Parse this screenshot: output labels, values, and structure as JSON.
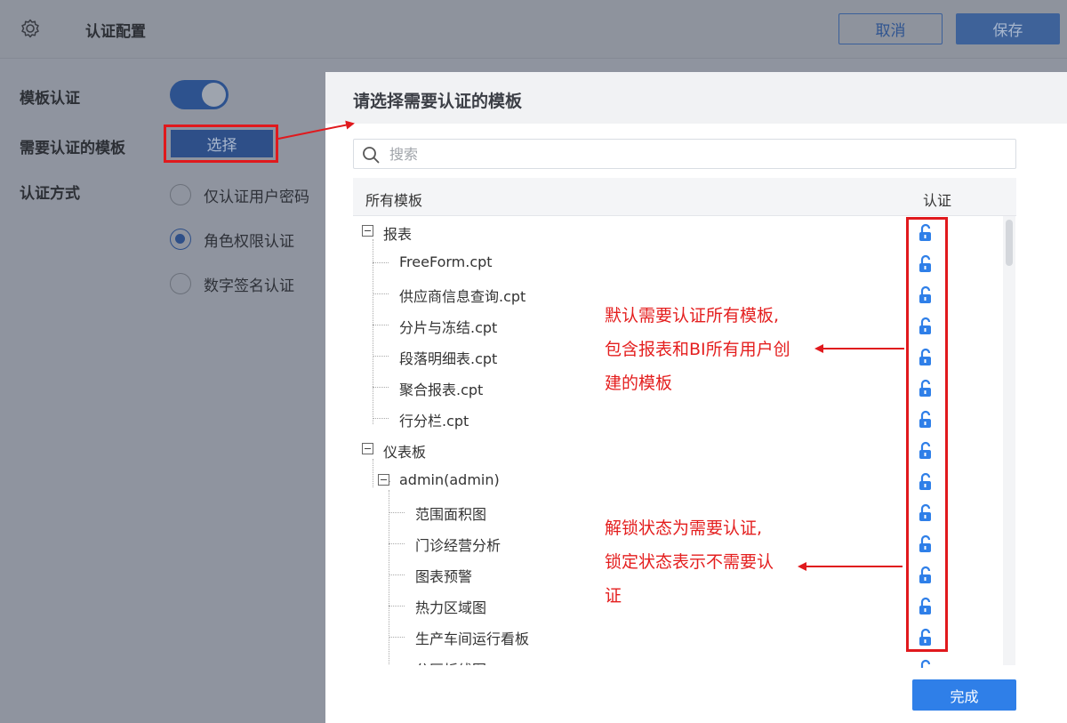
{
  "header": {
    "title": "认证配置",
    "cancel_label": "取消",
    "save_label": "保存"
  },
  "settings": {
    "template_auth_label": "模板认证",
    "template_auth_enabled": true,
    "need_auth_templates_label": "需要认证的模板",
    "select_label": "选择",
    "auth_method_label": "认证方式",
    "methods": [
      {
        "label": "仅认证用户密码",
        "selected": false
      },
      {
        "label": "角色权限认证",
        "selected": true
      },
      {
        "label": "数字签名认证",
        "selected": false
      }
    ]
  },
  "modal": {
    "title": "请选择需要认证的模板",
    "search_placeholder": "搜索",
    "col_templates": "所有模板",
    "col_auth": "认证",
    "tree": [
      {
        "label": "报表",
        "group": true
      },
      {
        "label": "FreeForm.cpt"
      },
      {
        "label": "供应商信息查询.cpt"
      },
      {
        "label": "分片与冻结.cpt"
      },
      {
        "label": "段落明细表.cpt"
      },
      {
        "label": "聚合报表.cpt"
      },
      {
        "label": "行分栏.cpt"
      },
      {
        "label": "仪表板",
        "group": true
      },
      {
        "label": "admin(admin)",
        "group": true
      },
      {
        "label": "范围面积图"
      },
      {
        "label": "门诊经营分析"
      },
      {
        "label": "图表预警"
      },
      {
        "label": "热力区域图"
      },
      {
        "label": "生产车间运行看板"
      },
      {
        "label": "分区折线图"
      }
    ],
    "lock_state": "unlocked",
    "done_label": "完成"
  },
  "annotations": {
    "note1": [
      "默认需要认证所有模板,",
      "包含报表和BI所有用户创",
      "建的模板"
    ],
    "note2": [
      "解锁状态为需要认证,",
      "锁定状态表示不需要认",
      "证"
    ]
  },
  "colors": {
    "accent": "#2f7fe8",
    "annotation_red": "#e0191d"
  }
}
